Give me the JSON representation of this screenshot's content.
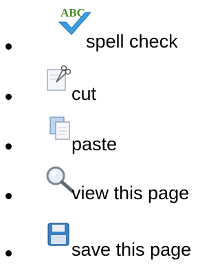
{
  "list": {
    "items": [
      {
        "icon": "spell-check-icon",
        "label": "spell check"
      },
      {
        "icon": "cut-icon",
        "label": "cut"
      },
      {
        "icon": "paste-icon",
        "label": "paste"
      },
      {
        "icon": "view-icon",
        "label": "view this page"
      },
      {
        "icon": "save-icon",
        "label": "save this page"
      }
    ]
  },
  "icons": {
    "spell_check_text": "ABC"
  },
  "colors": {
    "check_blue": "#3a9ee0",
    "abc_green": "#4a8a2a",
    "save_blue": "#3c7fc4"
  }
}
